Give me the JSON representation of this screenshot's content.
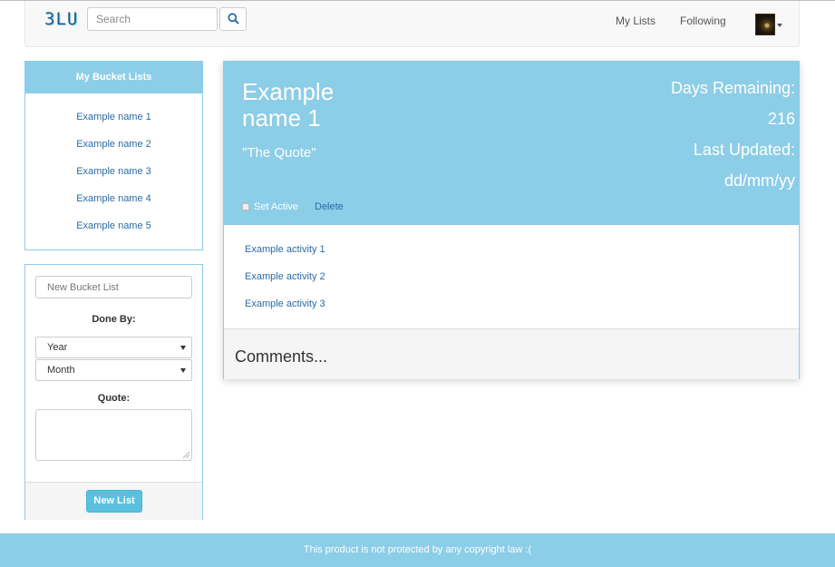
{
  "navbar": {
    "logo": "3LU",
    "search_placeholder": "Search",
    "links": [
      "My Lists",
      "Following"
    ]
  },
  "sidebar": {
    "lists_title": "My Bucket Lists",
    "items": [
      "Example name 1",
      "Example name 2",
      "Example name 3",
      "Example name 4",
      "Example name 5"
    ]
  },
  "form": {
    "new_list_placeholder": "New Bucket List",
    "done_by_label": "Done By:",
    "year_selected": "Year",
    "month_selected": "Month",
    "quote_label": "Quote:",
    "submit_label": "New List"
  },
  "card": {
    "title": "Example name 1",
    "quote": "\"The Quote\"",
    "days_remaining_label": "Days Remaining:",
    "days_remaining_value": "216",
    "last_updated_label": "Last Updated:",
    "last_updated_value": "dd/mm/yy",
    "set_active_label": "Set Active",
    "delete_label": "Delete",
    "activities": [
      "Example activity 1",
      "Example activity 2",
      "Example activity 3"
    ],
    "comments_label": "Comments..."
  },
  "footer": {
    "text": "This product is not protected by any copyright law :("
  },
  "colors": {
    "accent": "#8ccde8",
    "link": "#2a6ba8",
    "button": "#5bc0de"
  }
}
